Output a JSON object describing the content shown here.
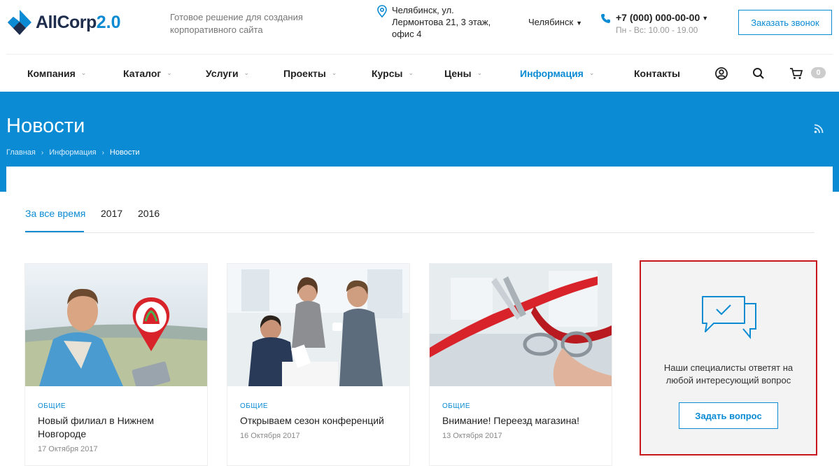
{
  "header": {
    "logo_text": "AllCorp",
    "logo_version": "2.0",
    "slogan": "Готовое решение для создания корпоративного сайта",
    "address": "Челябинск, ул. Лермонтова 21, 3 этаж, офис 4",
    "city": "Челябинск",
    "phone": "+7 (000) 000-00-00",
    "hours": "Пн - Вс: 10.00 - 19.00",
    "callback_label": "Заказать звонок"
  },
  "nav": {
    "items": [
      {
        "label": "Компания",
        "has_dropdown": true
      },
      {
        "label": "Каталог",
        "has_dropdown": true
      },
      {
        "label": "Услуги",
        "has_dropdown": true
      },
      {
        "label": "Проекты",
        "has_dropdown": true
      },
      {
        "label": "Курсы",
        "has_dropdown": true
      },
      {
        "label": "Цены",
        "has_dropdown": true
      },
      {
        "label": "Информация",
        "has_dropdown": true,
        "active": true
      },
      {
        "label": "Контакты",
        "has_dropdown": false
      }
    ],
    "icons": [
      "user-icon",
      "search-icon",
      "cart-icon"
    ],
    "cart_count": "0"
  },
  "page": {
    "title": "Новости",
    "breadcrumb": [
      "Главная",
      "Информация",
      "Новости"
    ]
  },
  "tabs": [
    "За все время",
    "2017",
    "2016"
  ],
  "news": [
    {
      "tag": "ОБЩИЕ",
      "title": "Новый филиал в Нижнем Новгороде",
      "date": "17 Октября 2017"
    },
    {
      "tag": "ОБЩИЕ",
      "title": "Открываем сезон конференций",
      "date": "16 Октября 2017"
    },
    {
      "tag": "ОБЩИЕ",
      "title": "Внимание! Переезд магазина!",
      "date": "13 Октября 2017"
    }
  ],
  "ask": {
    "text": "Наши специалисты ответят на любой интересующий вопрос",
    "button_label": "Задать вопрос"
  },
  "colors": {
    "accent": "#0b8bd4",
    "highlight_border": "#c8161d"
  }
}
